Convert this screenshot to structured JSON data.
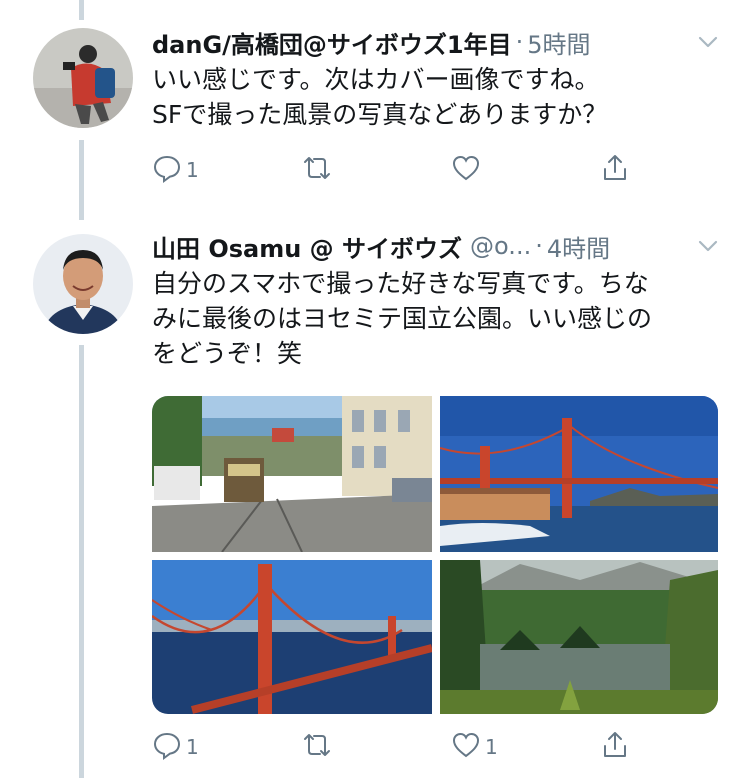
{
  "tweets": [
    {
      "name": "danG/高橋団@サイボウズ1年目",
      "handle": "",
      "time": "5時間",
      "text_lines": [
        "いい感じです。次はカバー画像ですね。",
        "SFで撮った風景の写真などありますか？"
      ],
      "reply_count": "1",
      "retweet_count": "",
      "like_count": ""
    },
    {
      "name": "山田 Osamu @ サイボウズ",
      "handle": "@o...",
      "time": "4時間",
      "text_lines": [
        "自分のスマホで撮った好きな写真です。ちな",
        "みに最後のはヨセミテ国立公園。いい感じの",
        "をどうぞ！笑"
      ],
      "reply_count": "1",
      "retweet_count": "",
      "like_count": "1"
    }
  ],
  "colors": {
    "text": "#14171a",
    "secondary": "#657786",
    "thread_line": "#ccd6dd"
  },
  "icons": [
    "reply-icon",
    "retweet-icon",
    "like-icon",
    "share-icon",
    "caret-down-icon"
  ]
}
